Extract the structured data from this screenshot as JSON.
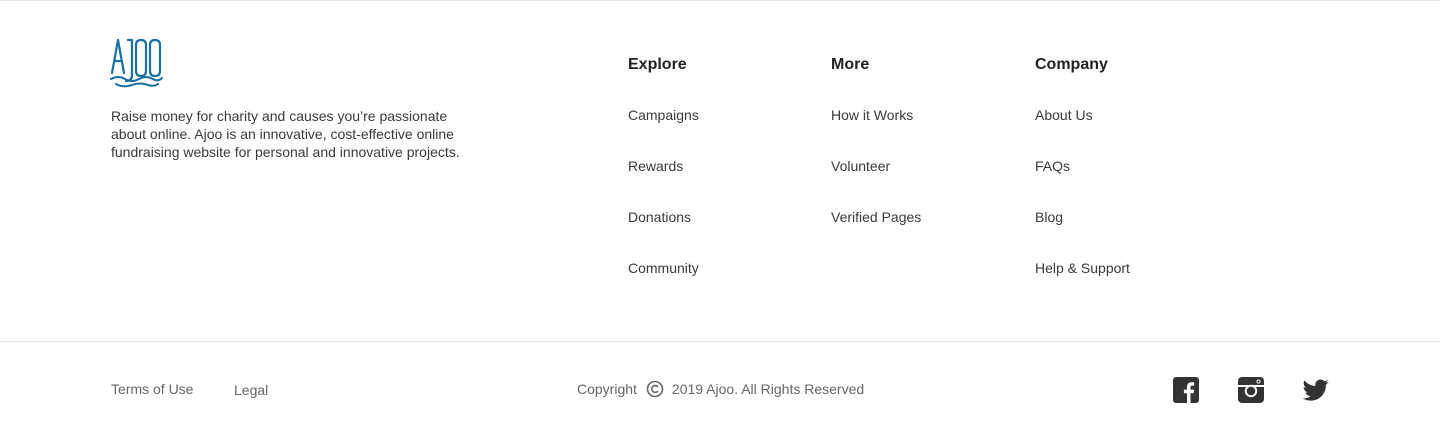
{
  "brand": {
    "logo_icon": "ajoo-logo",
    "logo_text": "AJOO",
    "accent_color": "#1a6fa3",
    "tagline": "Raise money for charity and causes you’re passionate about online. Ajoo is an innovative, cost-effective online fundraising website for personal and innovative projects."
  },
  "columns": [
    {
      "title": "Explore",
      "links": [
        "Campaigns",
        "Rewards",
        "Donations",
        "Community"
      ]
    },
    {
      "title": "More",
      "links": [
        "How it Works",
        "Volunteer",
        "Verified Pages"
      ]
    },
    {
      "title": "Company",
      "links": [
        "About Us",
        "FAQs",
        "Blog",
        "Help & Support"
      ]
    }
  ],
  "bottom": {
    "terms_label": "Terms of Use",
    "legal_label": "Legal",
    "copyright_prefix": "Copyright",
    "copyright_icon": "copyright-icon",
    "copyright_text": "2019 Ajoo. All Rights Reserved"
  },
  "social": [
    {
      "name": "facebook",
      "icon": "facebook-icon",
      "color": "#333333"
    },
    {
      "name": "instagram",
      "icon": "instagram-icon",
      "color": "#333333"
    },
    {
      "name": "twitter",
      "icon": "twitter-icon",
      "color": "#333333"
    }
  ]
}
